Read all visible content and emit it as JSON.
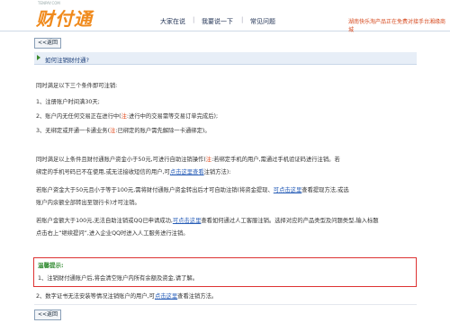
{
  "header": {
    "logo_text": "财付通",
    "logo_sub": "TENPAY.COM",
    "nav": [
      "大家在说",
      "我要说一下",
      "常见问题"
    ],
    "promo": "湖南快乐淘产品正在免费对接手台湘缘商城"
  },
  "back_label": "<<返回",
  "question_title": "如何注销财付通?",
  "intro": "同时满足以下三个条件即可注销:",
  "conditions": [
    {
      "a": "1、注册账户时间满30天;",
      "red": "",
      "b": ""
    },
    {
      "a": "2、账户内无任何交易正在进行中(",
      "red": "注",
      "b": ":进行中的交易需等交易订单完成后);"
    },
    {
      "a": "3、无绑定或开通一卡通业务(",
      "red": "注",
      "b": ":已绑定的账户需先解除一卡通绑定)。"
    }
  ],
  "para1": {
    "l1a": "同时满足以上条件且财付通账户资金小于50元,可进行自助注销操作(",
    "l1red": "注",
    "l1b": ":若绑定手机的用户,需通过手机验证码进行注销。若",
    "l2a": "绑定的手机号码已不在使用,或无法接收短信的用户,可",
    "l2link": "点击这里查看",
    "l2b": "注销方法):"
  },
  "para2": {
    "l1a": "若账户资金大于50元且小于等于100元,需将财付通账户资金转出后才可自助注销(将资金提现、",
    "l1link": "可点击这里",
    "l1b": "查看提现方法,或选",
    "l2": "账户内余额全部转出至银行卡)才可注销。"
  },
  "para3": {
    "l1a": "若账户金额大于100元,无法自助注销或QQ已申请成功,",
    "l1link": "可点击这里",
    "l1b": "查看如何通过人工客服注销。选择对应的产品类型及问题类型,输入标题",
    "l2": "点击右上“继续提问”,进入企业QQ时进入人工服务进行注销。"
  },
  "notice": {
    "title": "温馨提示:",
    "text": "1、注销财付通账户后,将会清空账户内所有余额及资金,请了解。"
  },
  "final_line": {
    "a": "2、数字证书无法安装等情况注销账户的用户,可",
    "link": "点击这里",
    "b": "查看注销方法。"
  }
}
